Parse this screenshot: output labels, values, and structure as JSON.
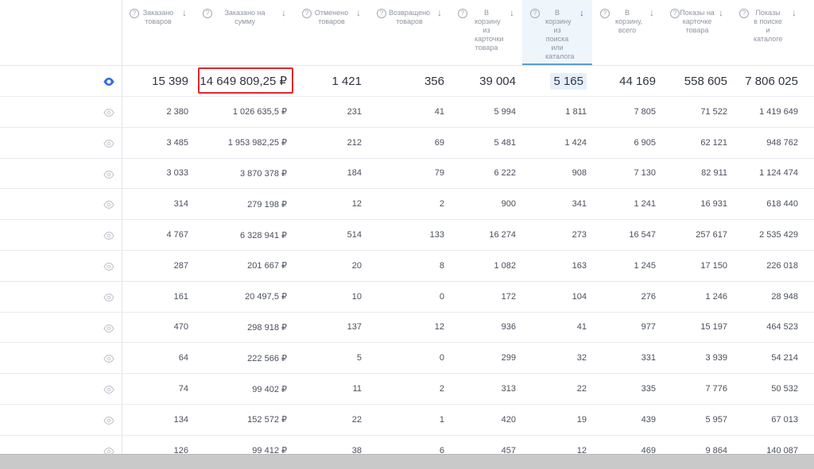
{
  "headers": [
    {
      "label": "Заказано товаров",
      "active": false
    },
    {
      "label": "Заказано на сумму",
      "active": false
    },
    {
      "label": "Отменено товаров",
      "active": false
    },
    {
      "label": "Возвращено товаров",
      "active": false
    },
    {
      "label": "В корзину из карточки товара",
      "active": false
    },
    {
      "label": "В корзину из поиска или каталога",
      "active": true
    },
    {
      "label": "В корзину, всего",
      "active": false
    },
    {
      "label": "Показы на карточке товара",
      "active": false
    },
    {
      "label": "Показы в поиске и каталоге",
      "active": false
    }
  ],
  "header_icons": {
    "help": "question-circle-icon",
    "sort": "arrow-down-icon",
    "help_glyph": "?",
    "sort_glyph": "↓"
  },
  "totals": [
    "15 399",
    "14 649 809,25 ₽",
    "1 421",
    "356",
    "39 004",
    "5 165",
    "44 169",
    "558 605",
    "7 806 025"
  ],
  "rows": [
    [
      "2 380",
      "1 026 635,5 ₽",
      "231",
      "41",
      "5 994",
      "1 811",
      "7 805",
      "71 522",
      "1 419 649"
    ],
    [
      "3 485",
      "1 953 982,25 ₽",
      "212",
      "69",
      "5 481",
      "1 424",
      "6 905",
      "62 121",
      "948 762"
    ],
    [
      "3 033",
      "3 870 378 ₽",
      "184",
      "79",
      "6 222",
      "908",
      "7 130",
      "82 911",
      "1 124 474"
    ],
    [
      "314",
      "279 198 ₽",
      "12",
      "2",
      "900",
      "341",
      "1 241",
      "16 931",
      "618 440"
    ],
    [
      "4 767",
      "6 328 941 ₽",
      "514",
      "133",
      "16 274",
      "273",
      "16 547",
      "257 617",
      "2 535 429"
    ],
    [
      "287",
      "201 667 ₽",
      "20",
      "8",
      "1 082",
      "163",
      "1 245",
      "17 150",
      "226 018"
    ],
    [
      "161",
      "20 497,5 ₽",
      "10",
      "0",
      "172",
      "104",
      "276",
      "1 246",
      "28 948"
    ],
    [
      "470",
      "298 918 ₽",
      "137",
      "12",
      "936",
      "41",
      "977",
      "15 197",
      "464 523"
    ],
    [
      "64",
      "222 566 ₽",
      "5",
      "0",
      "299",
      "32",
      "331",
      "3 939",
      "54 214"
    ],
    [
      "74",
      "99 402 ₽",
      "11",
      "2",
      "313",
      "22",
      "335",
      "7 776",
      "50 532"
    ],
    [
      "134",
      "152 572 ₽",
      "22",
      "1",
      "420",
      "19",
      "439",
      "5 957",
      "67 013"
    ],
    [
      "126",
      "99 412 ₽",
      "38",
      "6",
      "457",
      "12",
      "469",
      "9 864",
      "140 087"
    ]
  ],
  "colors": {
    "eye_active": "#3b6fd8",
    "eye_inactive": "#c3c7cf",
    "highlight_border": "#e0262c",
    "active_column_bg": "#eef5fb"
  }
}
